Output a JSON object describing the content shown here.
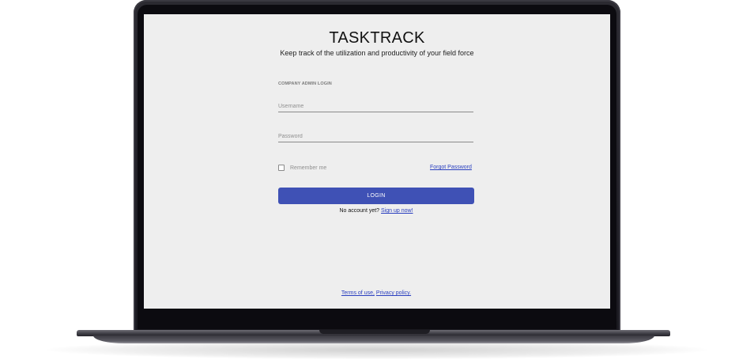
{
  "app": {
    "title": "TASKTRACK",
    "tagline": "Keep track of the utilization and productivity of your field force"
  },
  "login_form": {
    "section_label": "COMPANY ADMIN LOGIN",
    "username": {
      "placeholder": "Username",
      "value": ""
    },
    "password": {
      "placeholder": "Password",
      "value": ""
    },
    "remember_me": {
      "label": "Remember me",
      "checked": false
    },
    "forgot_password_label": "Forgot Password",
    "login_button_label": "LOGIN",
    "signup_prompt": "No account yet?",
    "signup_link_label": "Sign up now!"
  },
  "footer": {
    "terms_label": "Terms of use,",
    "privacy_label": "Privacy policy."
  },
  "colors": {
    "primary_button": "#3f51b5",
    "link": "#2a3fbf",
    "screen_background": "#eeeeee"
  }
}
